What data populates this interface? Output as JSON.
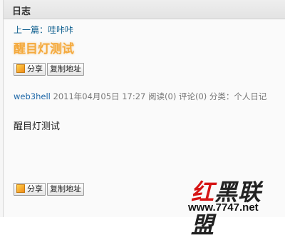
{
  "header": {
    "title": "日志"
  },
  "nav": {
    "prev_label": "上一篇：",
    "prev_title": "哇咔咔"
  },
  "post": {
    "title": "醒目灯测试",
    "author": "web3hell",
    "datetime": "2011年04月05日 17:27",
    "reads": "阅读(0)",
    "comments": "评论(0)",
    "category": "分类：个人日记",
    "body": "醒目灯测试"
  },
  "actions": {
    "share": "分享",
    "copy": "复制地址"
  },
  "watermark": {
    "first_char": "红",
    "rest": "黑联盟",
    "url": "www.7747.net"
  },
  "colors": {
    "title": "#f4a93c",
    "link": "#0a5c8c",
    "watermark_red": "#d61515"
  }
}
